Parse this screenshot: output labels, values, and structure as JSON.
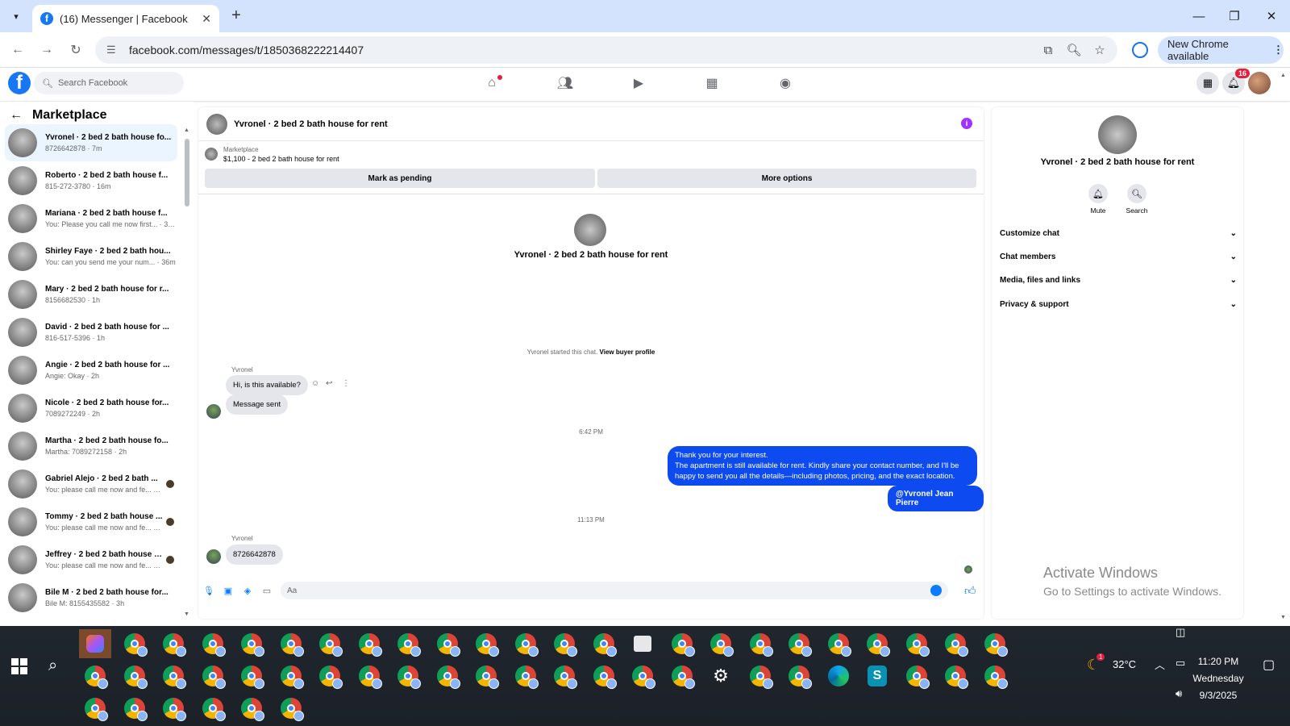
{
  "browser": {
    "tab_title": "(16) Messenger | Facebook",
    "url": "facebook.com/messages/t/1850368222214407",
    "new_chrome_label": "New Chrome available"
  },
  "fb": {
    "search_placeholder": "Search Facebook",
    "notification_count": "16"
  },
  "left": {
    "title": "Marketplace",
    "conversations": [
      {
        "name": "Yvronel · 2 bed 2 bath house fo...",
        "preview": "8726642878 · 7m",
        "active": true
      },
      {
        "name": "Roberto · 2 bed 2 bath house f...",
        "preview": "815-272-3780 · 16m"
      },
      {
        "name": "Mariana · 2 bed 2 bath house f...",
        "preview": "You: Please you call me now first... · 33m"
      },
      {
        "name": "Shirley Faye · 2 bed 2 bath hou...",
        "preview": "You: can you send me your num... · 36m"
      },
      {
        "name": "Mary · 2 bed 2 bath house for r...",
        "preview": "8156682530 · 1h"
      },
      {
        "name": "David · 2 bed 2 bath house for ...",
        "preview": "816-517-5396 · 1h"
      },
      {
        "name": "Angie · 2 bed 2 bath house for ...",
        "preview": "Angie: Okay · 2h"
      },
      {
        "name": "Nicole · 2 bed 2 bath house for...",
        "preview": "7089272249 · 2h"
      },
      {
        "name": "Martha · 2 bed 2 bath house fo...",
        "preview": "Martha: 7089272158 · 2h"
      },
      {
        "name": "Gabriel Alejo · 2 bed 2 bath ...",
        "preview": "You: please call me now and fe... · 3h"
      },
      {
        "name": "Tommy · 2 bed 2 bath house ...",
        "preview": "You: please call me now and fe... · 3h"
      },
      {
        "name": "Jeffrey · 2 bed 2 bath house f...",
        "preview": "You: please call me now and fe... · 3h"
      },
      {
        "name": "Bile M · 2 bed 2 bath house for...",
        "preview": "Bile M: 8155435582 · 3h"
      }
    ]
  },
  "chat": {
    "title": "Yvronel · 2 bed 2 bath house for rent",
    "marketplace_label": "Marketplace",
    "listing": "$1,100 - 2 bed 2 bath house for rent",
    "mark_pending": "Mark as pending",
    "more_options": "More options",
    "center_name": "Yvronel · 2 bed 2 bath house for rent",
    "started_text": "Yvronel started this chat.",
    "view_profile": "View buyer profile",
    "sender": "Yvronel",
    "msg1": "Hi, is this available?",
    "msg2": "Message sent",
    "time1": "6:42 PM",
    "out_line1": "Thank you for your interest.",
    "out_line2": "The apartment is still available for rent. Kindly share your contact number, and I'll be",
    "out_line3": "happy to send you all the details—including photos, pricing, and the exact location.",
    "mention": "@Yvronel Jean Pierre",
    "time2": "11:13 PM",
    "sender2": "Yvronel",
    "msg3": "8726642878",
    "composer_placeholder": "Aa"
  },
  "info": {
    "name": "Yvronel · 2 bed 2 bath house for rent",
    "mute": "Mute",
    "search": "Search",
    "sections": [
      "Customize chat",
      "Chat members",
      "Media, files and links",
      "Privacy & support"
    ]
  },
  "watermark": {
    "line1": "Activate Windows",
    "line2": "Go to Settings to activate Windows."
  },
  "taskbar": {
    "temperature": "32°C",
    "weather_badge": "1",
    "time": "11:20 PM",
    "day": "Wednesday",
    "date": "9/3/2025"
  }
}
